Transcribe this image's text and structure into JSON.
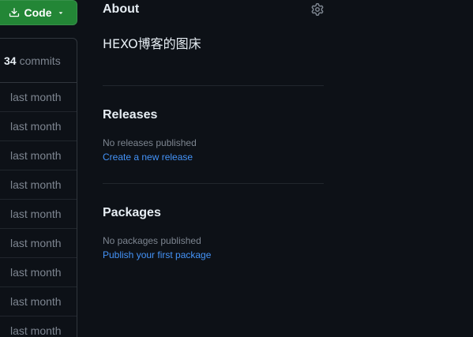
{
  "code_button": {
    "label": "Code"
  },
  "commits": {
    "count": "34",
    "label": "commits"
  },
  "file_rows": [
    "last month",
    "last month",
    "last month",
    "last month",
    "last month",
    "last month",
    "last month",
    "last month",
    "last month"
  ],
  "about": {
    "title": "About",
    "description": "HEXO博客的图床"
  },
  "releases": {
    "title": "Releases",
    "empty_text": "No releases published",
    "link": "Create a new release"
  },
  "packages": {
    "title": "Packages",
    "empty_text": "No packages published",
    "link": "Publish your first package"
  },
  "colors": {
    "background": "#0d1117",
    "accent_green": "#238636",
    "link_blue": "#4493f8",
    "muted": "#7d8590"
  },
  "icons": {
    "code_download": "download-icon",
    "code_caret": "triangle-down-icon",
    "about_settings": "gear-icon"
  }
}
